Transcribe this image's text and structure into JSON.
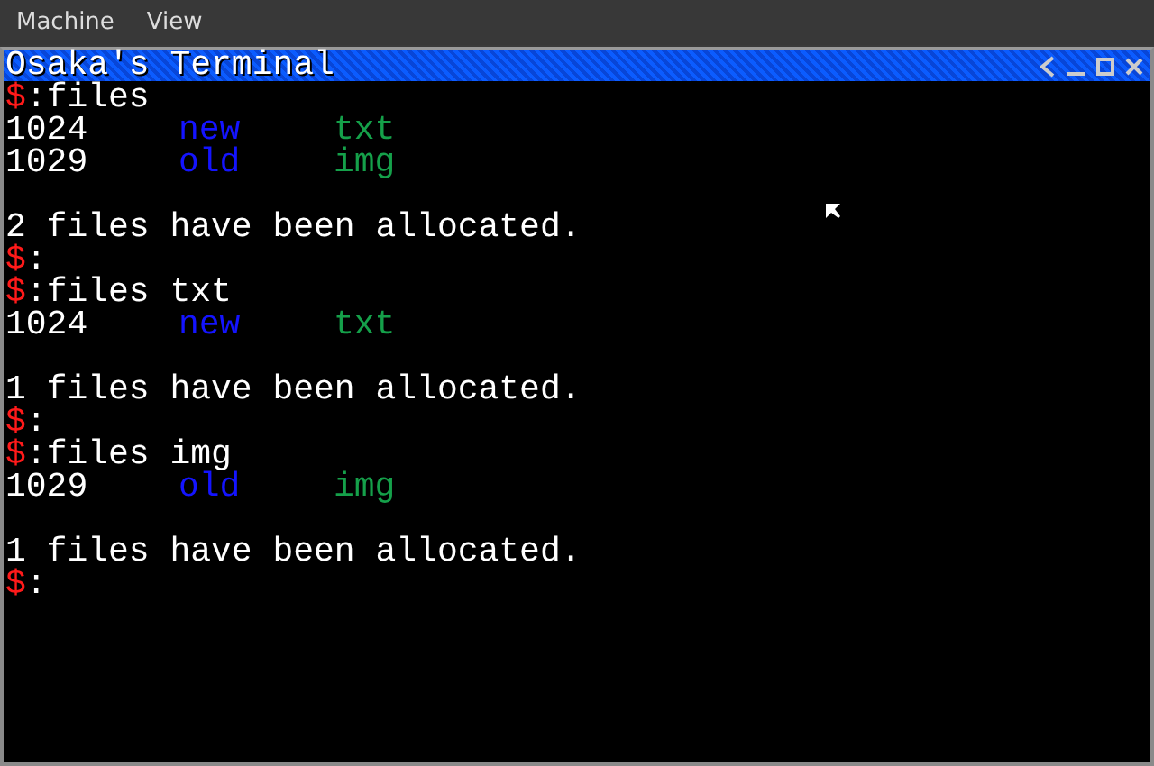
{
  "menu_bar": {
    "items": [
      "Machine",
      "View"
    ]
  },
  "window": {
    "title": "Osaka's Terminal"
  },
  "terminal": {
    "lines": [
      {
        "kind": "prompt",
        "symbol": "$",
        "separator": ":",
        "command": "files"
      },
      {
        "kind": "file",
        "id": "1024",
        "name": "new",
        "type": "txt"
      },
      {
        "kind": "file",
        "id": "1029",
        "name": "old",
        "type": "img"
      },
      {
        "kind": "blank"
      },
      {
        "kind": "message",
        "text": "2 files have been allocated."
      },
      {
        "kind": "prompt",
        "symbol": "$",
        "separator": ":"
      },
      {
        "kind": "prompt",
        "symbol": "$",
        "separator": ":",
        "command": "files txt"
      },
      {
        "kind": "file",
        "id": "1024",
        "name": "new",
        "type": "txt"
      },
      {
        "kind": "blank"
      },
      {
        "kind": "message",
        "text": "1 files have been allocated."
      },
      {
        "kind": "prompt",
        "symbol": "$",
        "separator": ":"
      },
      {
        "kind": "prompt",
        "symbol": "$",
        "separator": ":",
        "command": "files img"
      },
      {
        "kind": "file",
        "id": "1029",
        "name": "old",
        "type": "img"
      },
      {
        "kind": "blank"
      },
      {
        "kind": "message",
        "text": "1 files have been allocated."
      },
      {
        "kind": "prompt",
        "symbol": "$",
        "separator": ":"
      }
    ]
  }
}
